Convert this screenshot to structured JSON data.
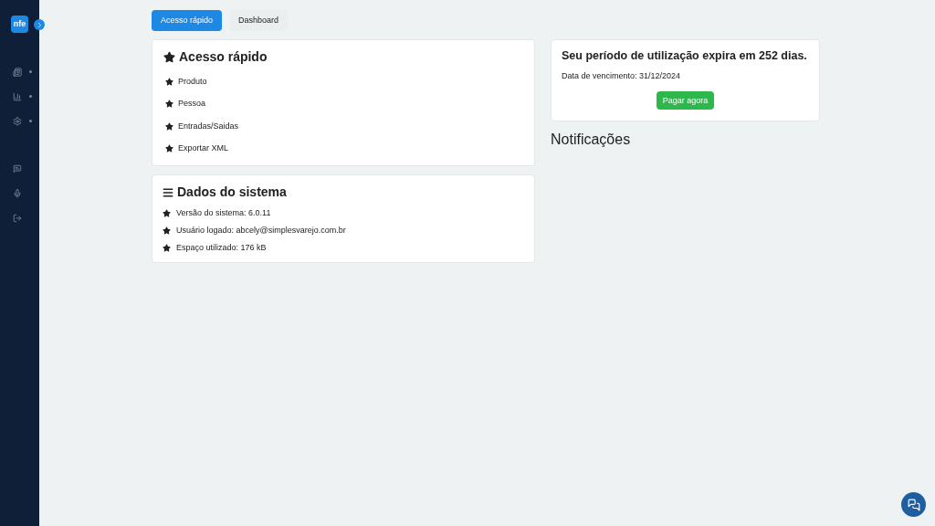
{
  "sidebar": {
    "logo": "nfe",
    "items": [
      {
        "expandable": true
      },
      {
        "expandable": true
      },
      {
        "expandable": true
      },
      {
        "expandable": false
      },
      {
        "expandable": false
      },
      {
        "expandable": false
      }
    ]
  },
  "tabs": [
    {
      "label": "Acesso rápido",
      "selected": true
    },
    {
      "label": "Dashboard",
      "selected": false
    }
  ],
  "quick_access": {
    "title": "Acesso rápido",
    "items": [
      "Produto",
      "Pessoa",
      "Entradas/Saidas",
      "Exportar XML"
    ]
  },
  "system_data": {
    "title": "Dados do sistema",
    "items": [
      "Versão do sistema: 6.0.11",
      "Usuário logado: abcely@simplesvarejo.com.br",
      "Espaço utilizado: 176 kB"
    ]
  },
  "license": {
    "title": "Seu período de utilização expira em 252 dias.",
    "due_date": "Data de vencimento: 31/12/2024",
    "button": "Pagar agora"
  },
  "notifications": {
    "title": "Notificações"
  }
}
